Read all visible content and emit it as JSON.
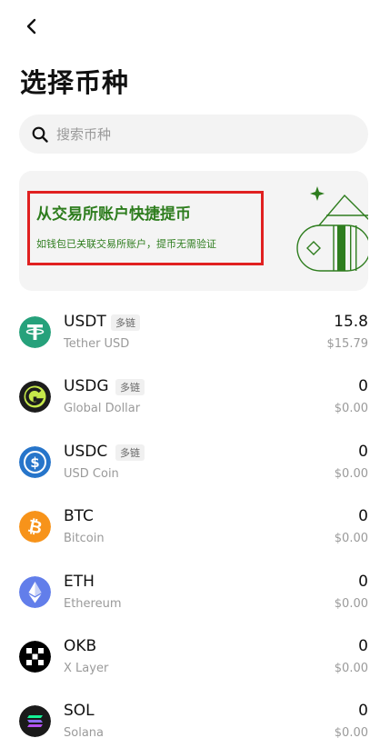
{
  "header": {
    "title": "选择币种"
  },
  "search": {
    "placeholder": "搜索币种"
  },
  "banner": {
    "title": "从交易所账户快捷提币",
    "subtitle": "如钱包已关联交易所账户，提币无需验证",
    "highlight_color": "#e02020",
    "text_color": "#2e7d1e"
  },
  "coins": [
    {
      "symbol": "USDT",
      "badge": "多链",
      "name": "Tether USD",
      "amount": "15.8",
      "usd": "$15.79",
      "icon": "tether-icon",
      "color": "#26a17b"
    },
    {
      "symbol": "USDG",
      "badge": "多链",
      "name": "Global Dollar",
      "amount": "0",
      "usd": "$0.00",
      "icon": "global-dollar-icon",
      "color": "#1c1c1c"
    },
    {
      "symbol": "USDC",
      "badge": "多链",
      "name": "USD Coin",
      "amount": "0",
      "usd": "$0.00",
      "icon": "usd-coin-icon",
      "color": "#2775ca"
    },
    {
      "symbol": "BTC",
      "badge": "",
      "name": "Bitcoin",
      "amount": "0",
      "usd": "$0.00",
      "icon": "bitcoin-icon",
      "color": "#f7931a"
    },
    {
      "symbol": "ETH",
      "badge": "",
      "name": "Ethereum",
      "amount": "0",
      "usd": "$0.00",
      "icon": "ethereum-icon",
      "color": "#627eea"
    },
    {
      "symbol": "OKB",
      "badge": "",
      "name": "X Layer",
      "amount": "0",
      "usd": "$0.00",
      "icon": "okb-icon",
      "color": "#000000"
    },
    {
      "symbol": "SOL",
      "badge": "",
      "name": "Solana",
      "amount": "0",
      "usd": "$0.00",
      "icon": "solana-icon",
      "color": "#1a1a1a"
    }
  ]
}
